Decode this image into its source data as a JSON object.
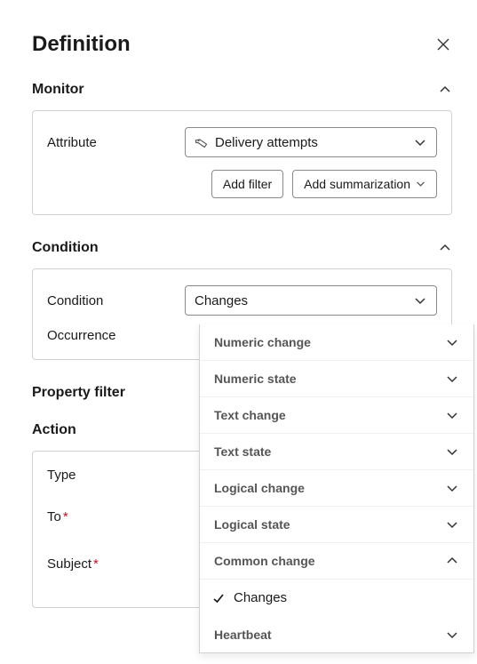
{
  "header": {
    "title": "Definition"
  },
  "monitor": {
    "title": "Monitor",
    "attribute_label": "Attribute",
    "attribute_value": "Delivery attempts",
    "add_filter": "Add filter",
    "add_summarization": "Add summarization"
  },
  "condition": {
    "title": "Condition",
    "condition_label": "Condition",
    "condition_value": "Changes",
    "occurrence_label": "Occurrence",
    "dropdown": {
      "groups": [
        {
          "label": "Numeric change",
          "expanded": false
        },
        {
          "label": "Numeric state",
          "expanded": false
        },
        {
          "label": "Text change",
          "expanded": false
        },
        {
          "label": "Text state",
          "expanded": false
        },
        {
          "label": "Logical change",
          "expanded": false
        },
        {
          "label": "Logical state",
          "expanded": false
        },
        {
          "label": "Common change",
          "expanded": true
        },
        {
          "label": "Heartbeat",
          "expanded": false
        }
      ],
      "selected_item": "Changes"
    }
  },
  "property_filter": {
    "title": "Property filter"
  },
  "action": {
    "title": "Action",
    "type_label": "Type",
    "to_label": "To",
    "subject_label": "Subject"
  }
}
